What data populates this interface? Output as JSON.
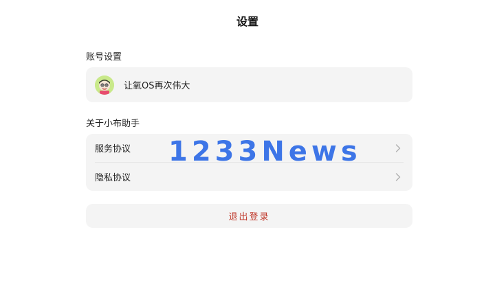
{
  "header": {
    "title": "设置"
  },
  "account_section": {
    "heading": "账号设置",
    "account_name": "让氧OS再次伟大",
    "avatar_icon": "cartoon-avatar-icon"
  },
  "about_section": {
    "heading": "关于小布助手",
    "items": [
      {
        "label": "服务协议",
        "icon": "chevron-right-icon"
      },
      {
        "label": "隐私协议",
        "icon": "chevron-right-icon"
      }
    ]
  },
  "logout": {
    "label": "退出登录",
    "color": "#c0392b"
  },
  "watermark": {
    "text": "1233News",
    "color": "#2e6be6"
  }
}
